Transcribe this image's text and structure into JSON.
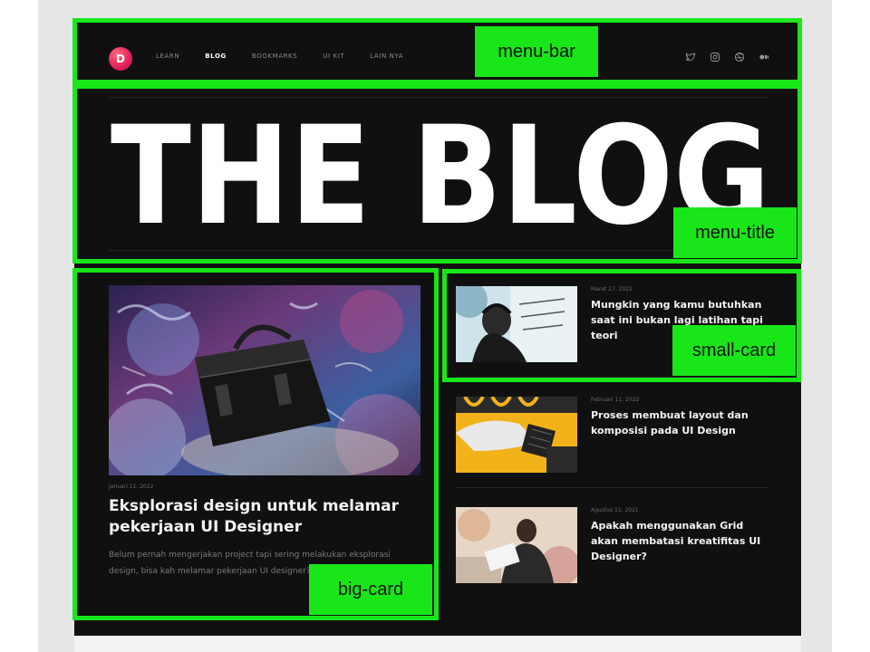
{
  "nav": {
    "logo_letter": "D",
    "items": [
      {
        "label": "LEARN",
        "active": false
      },
      {
        "label": "BLOG",
        "active": true
      },
      {
        "label": "BOOKMARKS",
        "active": false
      },
      {
        "label": "UI KIT",
        "active": false
      },
      {
        "label": "LAIN NYA",
        "active": false
      }
    ],
    "socials": [
      "twitter-icon",
      "instagram-icon",
      "dribbble-icon",
      "medium-icon"
    ]
  },
  "hero": {
    "title": "THE BLOG"
  },
  "big_card": {
    "date": "Januari 11, 2022",
    "title": "Eksplorasi design untuk melamar pekerjaan UI Designer",
    "excerpt": "Belum pernah mengerjakan project tapi sering melakukan eksplorasi design, bisa kah melamar pekerjaan UI designer?"
  },
  "small_cards": [
    {
      "date": "Maret 27, 2022",
      "title": "Mungkin yang kamu butuhkan saat ini bukan lagi latihan tapi teori"
    },
    {
      "date": "Februari 11, 2022",
      "title": "Proses membuat layout dan komposisi pada UI Design"
    },
    {
      "date": "Agustus 11, 2021",
      "title": "Apakah menggunakan Grid akan membatasi kreatifitas UI Designer?"
    }
  ],
  "annotations": {
    "menu_bar": "menu-bar",
    "menu_title": "menu-title",
    "small_card": "small-card",
    "big_card": "big-card"
  },
  "colors": {
    "accent_green": "#19e619",
    "page_bg": "#101010",
    "logo_pink": "#e0205a"
  }
}
